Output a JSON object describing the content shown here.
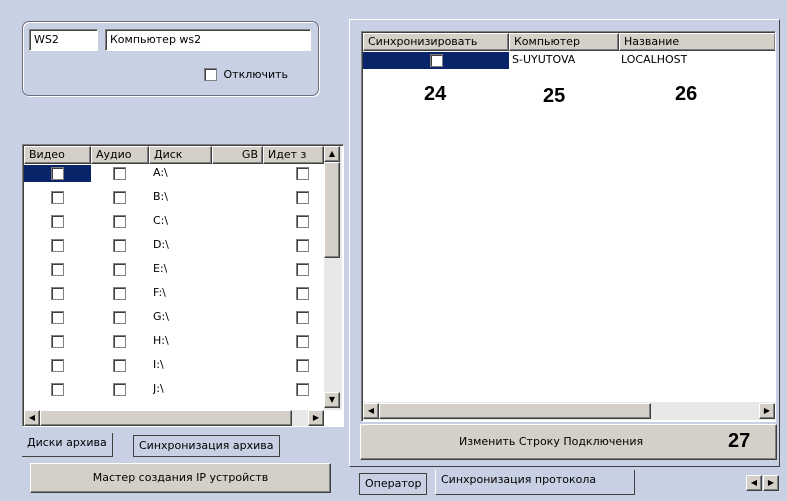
{
  "computer": {
    "code": "WS2",
    "name": "Компьютер ws2",
    "disable_label": "Отключить"
  },
  "disks_table": {
    "columns": [
      "Видео",
      "Аудио",
      "Диск",
      "GB",
      "Идет з"
    ],
    "rows": [
      {
        "disk": "A:\\"
      },
      {
        "disk": "B:\\"
      },
      {
        "disk": "C:\\"
      },
      {
        "disk": "D:\\"
      },
      {
        "disk": "E:\\"
      },
      {
        "disk": "F:\\"
      },
      {
        "disk": "G:\\"
      },
      {
        "disk": "H:\\"
      },
      {
        "disk": "I:\\"
      },
      {
        "disk": "J:\\"
      }
    ]
  },
  "left_tabs": [
    "Диски архива",
    "Синхронизация архива"
  ],
  "ip_wizard_button": "Мастер создания IP устройств",
  "sync_table": {
    "columns": [
      "Синхронизировать",
      "Компьютер",
      "Название"
    ],
    "row": {
      "computer": "S-UYUTOVA",
      "name": "LOCALHOST"
    }
  },
  "callouts": {
    "c24": "24",
    "c25": "25",
    "c26": "26",
    "c27": "27"
  },
  "change_connection_button": "Изменить Строку Подключения",
  "right_tabs": [
    "Оператор",
    "Синхронизация протокола"
  ],
  "colors": {
    "selection": "#0a246a",
    "panel": "#c8d0e4",
    "face": "#d4d0c8"
  }
}
